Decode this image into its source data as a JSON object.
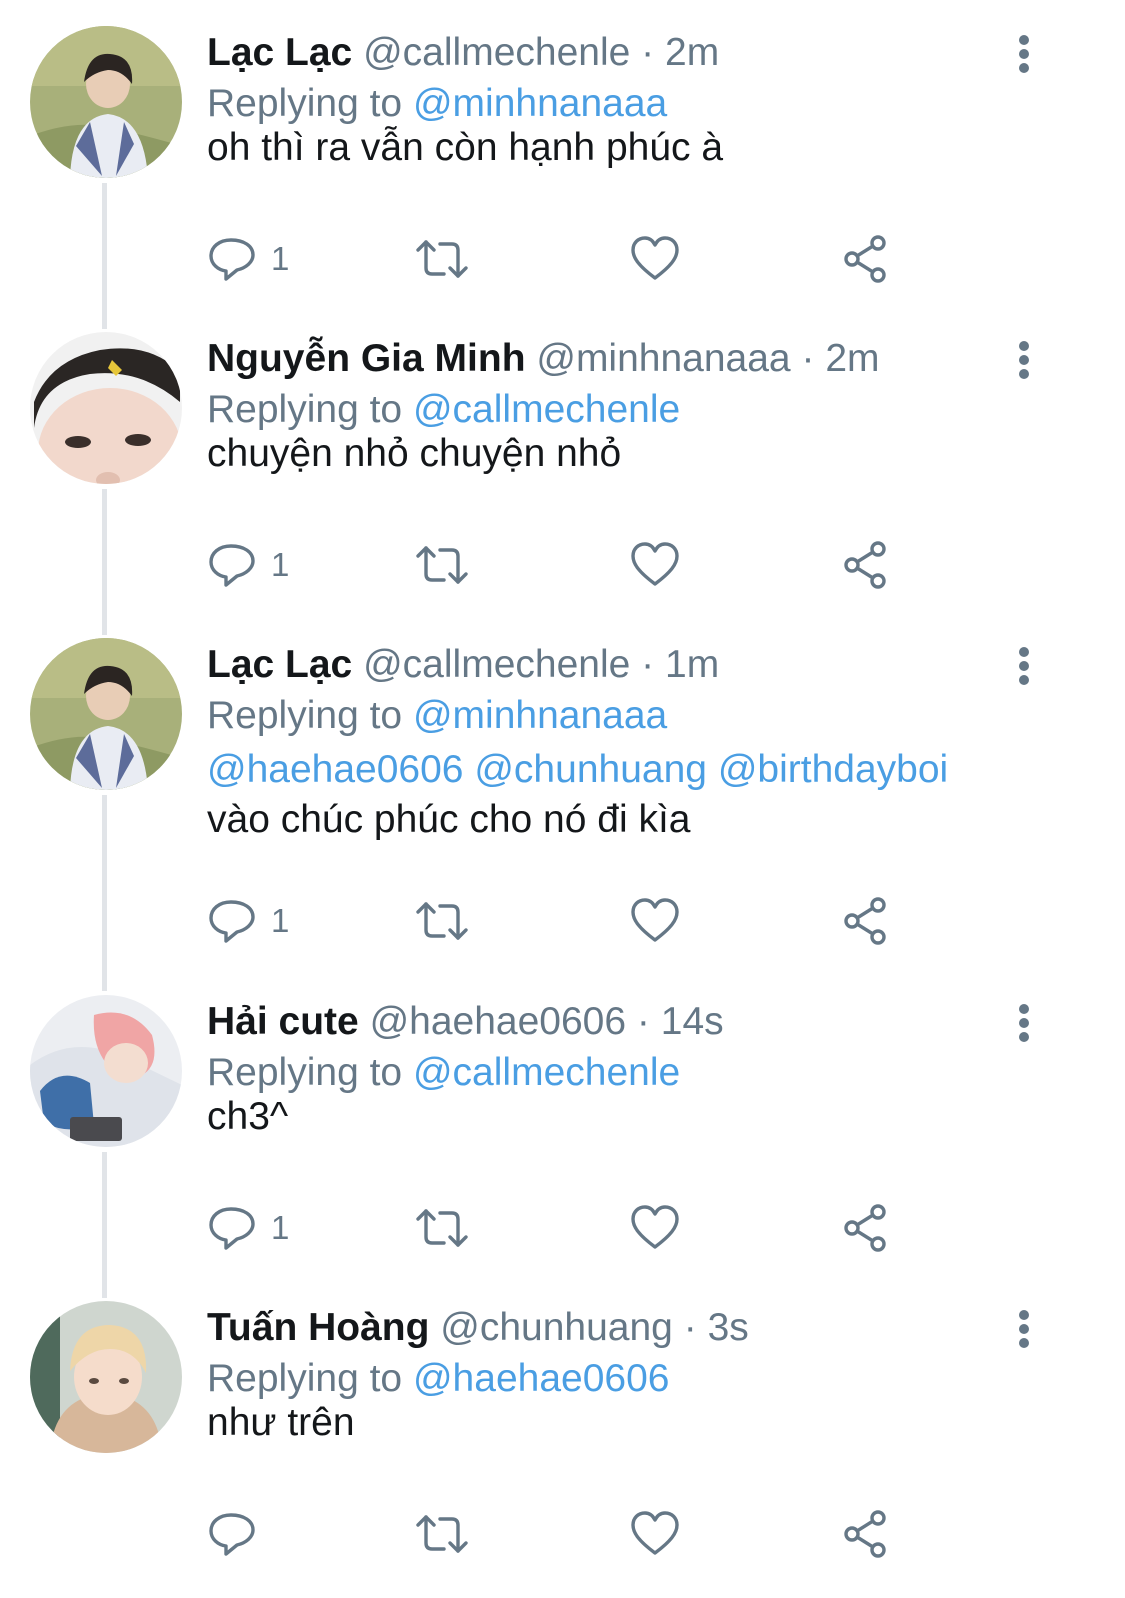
{
  "colors": {
    "link": "#4a9ee3",
    "muted": "#657786",
    "text": "#14171a",
    "thread_line": "#e1e4e8"
  },
  "icons": {
    "reply": "reply-icon",
    "retweet": "retweet-icon",
    "like": "heart-icon",
    "share": "share-icon",
    "more": "more-vertical-icon"
  },
  "tweets": [
    {
      "name": "Lạc Lạc",
      "handle": "@callmechenle",
      "separator": "·",
      "time": "2m",
      "replying_prefix": "Replying to",
      "replying_to": "@minhnanaaa",
      "text": "oh thì ra vẫn còn hạnh phúc à",
      "reply_count": "1"
    },
    {
      "name": "Nguyễn Gia Minh",
      "handle": "@minhnanaaa",
      "separator": "·",
      "time": "2m",
      "replying_prefix": "Replying to",
      "replying_to": "@callmechenle",
      "text": "chuyện nhỏ chuyện nhỏ",
      "reply_count": "1"
    },
    {
      "name": "Lạc Lạc",
      "handle": "@callmechenle",
      "separator": "·",
      "time": "1m",
      "replying_prefix": "Replying to",
      "replying_to": "@minhnanaaa",
      "mentions": [
        "@haehae0606",
        "@chunhuang",
        "@birthdayboi"
      ],
      "text": "vào chúc phúc cho nó đi kìa",
      "reply_count": "1"
    },
    {
      "name": "Hải cute",
      "handle": "@haehae0606",
      "separator": "·",
      "time": "14s",
      "replying_prefix": "Replying to",
      "replying_to": "@callmechenle",
      "text": "ch3^",
      "reply_count": "1"
    },
    {
      "name": "Tuấn Hoàng",
      "handle": "@chunhuang",
      "separator": "·",
      "time": "3s",
      "replying_prefix": "Replying to",
      "replying_to": "@haehae0606",
      "text": "như trên",
      "reply_count": ""
    }
  ]
}
